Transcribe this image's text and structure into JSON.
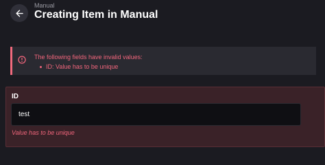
{
  "header": {
    "breadcrumb": "Manual",
    "title": "Creating Item in Manual",
    "back_icon": "arrow-left-icon"
  },
  "alert": {
    "icon": "alert-circle-icon",
    "title": "The following fields have invalid values:",
    "items": [
      "ID: Value has to be unique"
    ],
    "color": "#f2667c"
  },
  "form": {
    "id_field": {
      "label": "ID",
      "value": "test",
      "error": "Value has to be unique"
    }
  }
}
